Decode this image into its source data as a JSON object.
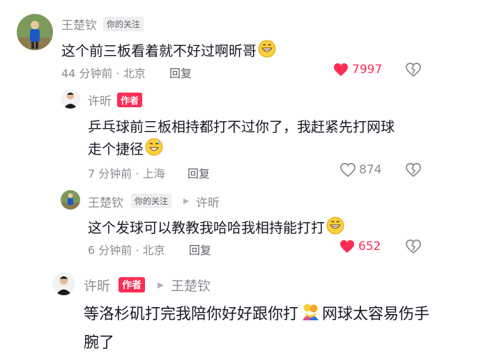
{
  "comments": [
    {
      "name": "王楚钦",
      "badge": "你的关注",
      "text": "这个前三板看着就不好过啊昕哥",
      "emoji": "grinning-face-emoji",
      "meta": "44 分钟前 · 北京",
      "reply": "回复",
      "likes": "7997",
      "liked": true
    },
    {
      "name": "许昕",
      "author_badge": "作者",
      "text_line1": "乒乓球前三板相持都打不过你了，我赶紧先打网球",
      "text_line2": "走个捷径",
      "emoji": "sweat-smile-emoji",
      "meta": "7 分钟前 · 上海",
      "reply": "回复",
      "likes": "874",
      "liked": false
    },
    {
      "name": "王楚钦",
      "badge": "你的关注",
      "reply_to": "许昕",
      "text": "这个发球可以教教我哈哈我相持能打打",
      "emoji": "grinning-face-emoji",
      "meta": "6 分钟前 · 北京",
      "reply": "回复",
      "likes": "652",
      "liked": true
    },
    {
      "name": "许昕",
      "author_badge": "作者",
      "reply_to": "王楚钦",
      "text_line1": "等洛杉矶打完我陪你好好跟你打",
      "text_line1b": "网球太容易伤手",
      "text_line2": "腕了",
      "emoji": "hugging-people-emoji"
    }
  ],
  "colors": {
    "accent": "#fe2c55",
    "muted": "#8a8b91"
  }
}
